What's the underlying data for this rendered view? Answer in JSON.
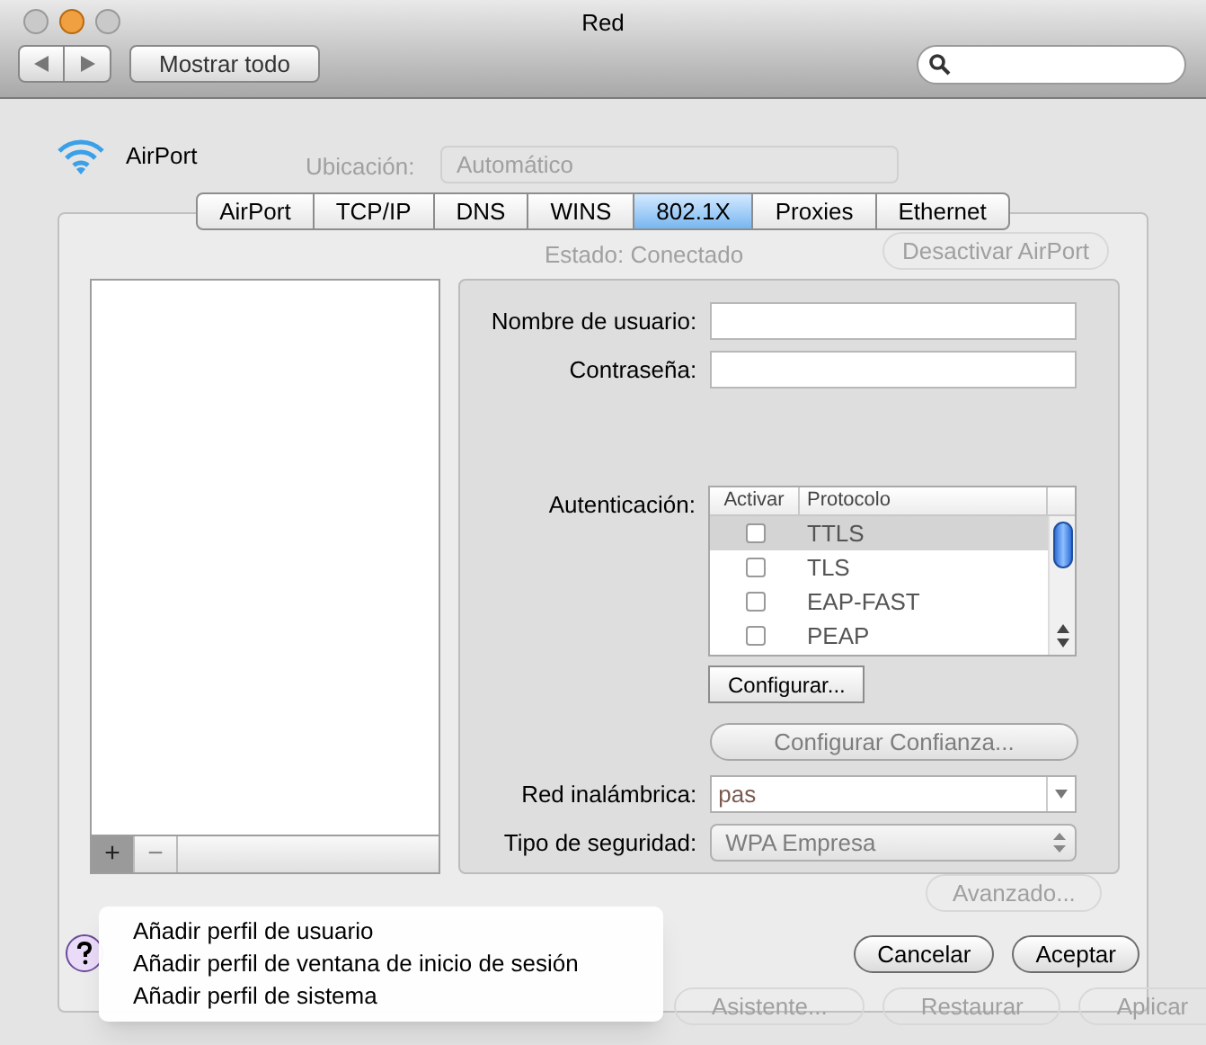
{
  "window": {
    "title": "Red"
  },
  "toolbar": {
    "show_all": "Mostrar todo"
  },
  "service": {
    "name": "AirPort"
  },
  "background": {
    "location_label": "Ubicación:",
    "location_value": "Automático",
    "status_label": "Estado:",
    "status_value": "Conectado",
    "toggle_button": "Desactivar AirPort",
    "advanced_button": "Avanzado...",
    "bottom_buttons": [
      "Asistente...",
      "Restaurar",
      "Aplicar"
    ]
  },
  "tabs": [
    {
      "label": "AirPort",
      "selected": false
    },
    {
      "label": "TCP/IP",
      "selected": false
    },
    {
      "label": "DNS",
      "selected": false
    },
    {
      "label": "WINS",
      "selected": false
    },
    {
      "label": "802.1X",
      "selected": true
    },
    {
      "label": "Proxies",
      "selected": false
    },
    {
      "label": "Ethernet",
      "selected": false
    }
  ],
  "profile_list": {
    "add": {
      "label": "+",
      "pressed": true
    },
    "remove": {
      "label": "−",
      "pressed": false
    }
  },
  "fields": [
    {
      "label": "Nombre de usuario:"
    },
    {
      "label": "Contraseña:"
    }
  ],
  "authentication": {
    "label": "Autenticación:",
    "columns": [
      "Activar",
      "Protocolo"
    ],
    "rows": [
      {
        "protocol": "TTLS",
        "checked": false,
        "selected": true
      },
      {
        "protocol": "TLS",
        "checked": false,
        "selected": false
      },
      {
        "protocol": "EAP-FAST",
        "checked": false,
        "selected": false
      },
      {
        "protocol": "PEAP",
        "checked": false,
        "selected": false
      }
    ]
  },
  "configure_button": "Configurar...",
  "trust_button": {
    "label": "Configurar Confianza...",
    "disabled": true
  },
  "wireless": {
    "label": "Red inalámbrica:",
    "value": "pas"
  },
  "security": {
    "label": "Tipo de seguridad:",
    "value": "WPA Empresa",
    "disabled": true
  },
  "menu": {
    "items": [
      "Añadir perfil de usuario",
      "Añadir perfil de ventana de inicio de sesión",
      "Añadir perfil de sistema"
    ]
  },
  "buttons": [
    "Cancelar",
    "Aceptar"
  ]
}
